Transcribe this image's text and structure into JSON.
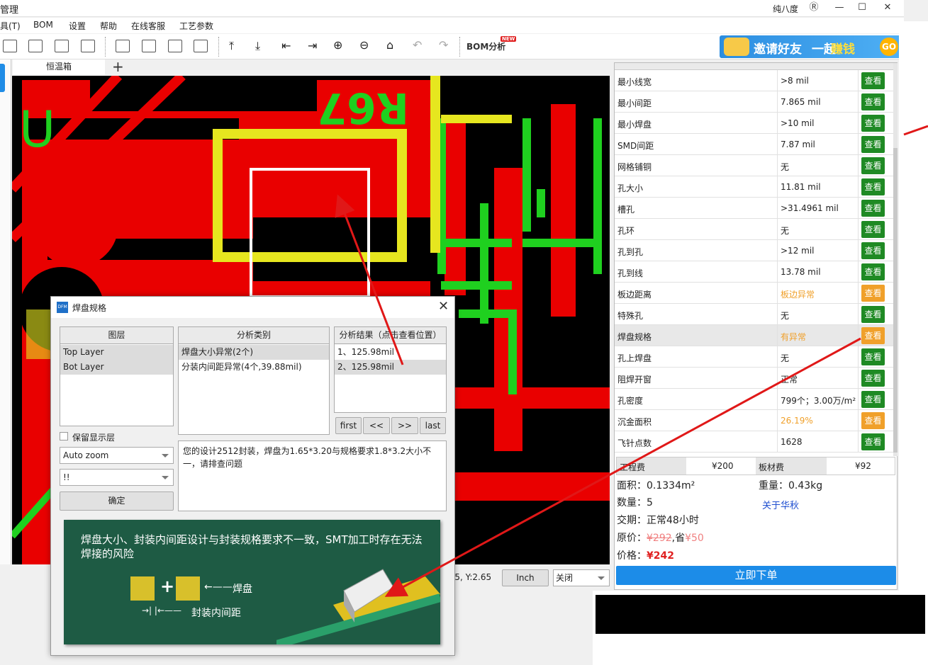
{
  "window": {
    "title": "管理",
    "user": "纯八度"
  },
  "menu": [
    "具(T)",
    "BOM",
    "设置",
    "帮助",
    "在线客服",
    "工艺参数"
  ],
  "toolbar": {
    "bom_label": "BOM分析",
    "bom_badge": "NEW"
  },
  "banner": {
    "text1": "邀请好友",
    "text2": "一起",
    "text3": "赚钱",
    "go": "GO"
  },
  "tabs": {
    "active": "恒温箱",
    "plus": "+"
  },
  "pcb_labels": [
    "R67",
    "U"
  ],
  "status": {
    "coord": "X:1.95, Y:2.65",
    "unit": "Inch",
    "layer_select": "关闭"
  },
  "rules": [
    {
      "name": "最小线宽",
      "value": ">8 mil",
      "status": "ok"
    },
    {
      "name": "最小间距",
      "value": "7.865 mil",
      "status": "ok"
    },
    {
      "name": "最小焊盘",
      "value": ">10 mil",
      "status": "ok"
    },
    {
      "name": "SMD间距",
      "value": "7.87 mil",
      "status": "ok"
    },
    {
      "name": "网格铺铜",
      "value": "无",
      "status": "ok"
    },
    {
      "name": "孔大小",
      "value": "11.81 mil",
      "status": "ok"
    },
    {
      "name": "槽孔",
      "value": ">31.4961 mil",
      "status": "ok"
    },
    {
      "name": "孔环",
      "value": "无",
      "status": "ok"
    },
    {
      "name": "孔到孔",
      "value": ">12 mil",
      "status": "ok"
    },
    {
      "name": "孔到线",
      "value": "13.78 mil",
      "status": "ok"
    },
    {
      "name": "板边距离",
      "value": "板边异常",
      "status": "warn"
    },
    {
      "name": "特殊孔",
      "value": "无",
      "status": "ok"
    },
    {
      "name": "焊盘规格",
      "value": "有异常",
      "status": "warn",
      "selected": true
    },
    {
      "name": "孔上焊盘",
      "value": "无",
      "status": "ok"
    },
    {
      "name": "阻焊开窗",
      "value": "正常",
      "status": "ok"
    },
    {
      "name": "孔密度",
      "value": "799个；3.00万/m²",
      "status": "ok"
    },
    {
      "name": "沉金面积",
      "value": "26.19%",
      "status": "warn"
    },
    {
      "name": "飞针点数",
      "value": "1628",
      "status": "ok"
    }
  ],
  "view_label": "查看",
  "fees": {
    "eng_label": "工程费",
    "eng_value": "¥200",
    "board_label": "板材费",
    "board_value": "¥92"
  },
  "summary": {
    "area": "面积：0.1334m²",
    "weight": "重量：0.43kg",
    "qty": "数量：5",
    "about": "关于华秋",
    "lead": "交期：正常48小时",
    "orig_label": "原价：",
    "orig_value": "¥292",
    "save_label": ",省",
    "save_value": "¥50",
    "price_label": "价格：",
    "price_value": "¥242",
    "order": "立即下单"
  },
  "dialog": {
    "title": "焊盘规格",
    "icon": "DFM",
    "layers_header": "图层",
    "layers": [
      "Top Layer",
      "Bot Layer"
    ],
    "type_header": "分析类别",
    "types": [
      "焊盘大小异常(2个)",
      "分装内间距异常(4个,39.88mil)"
    ],
    "result_header": "分析结果（点击查看位置）",
    "results": [
      "1、125.98mil",
      "2、125.98mil"
    ],
    "keep_layer": "保留显示层",
    "zoom": "Auto zoom",
    "mark": "!!",
    "ok": "确定",
    "nav": [
      "first",
      "<<",
      ">>",
      "last"
    ],
    "note": "您的设计2512封装，焊盘为1.65*3.20与规格要求1.8*3.2大小不一，请排查问题",
    "illus_caption": "焊盘大小、封装内间距设计与封装规格要求不一致，SMT加工时存在无法焊接的风险",
    "illus_pad": "焊盘",
    "illus_gap": "封装内间距"
  }
}
